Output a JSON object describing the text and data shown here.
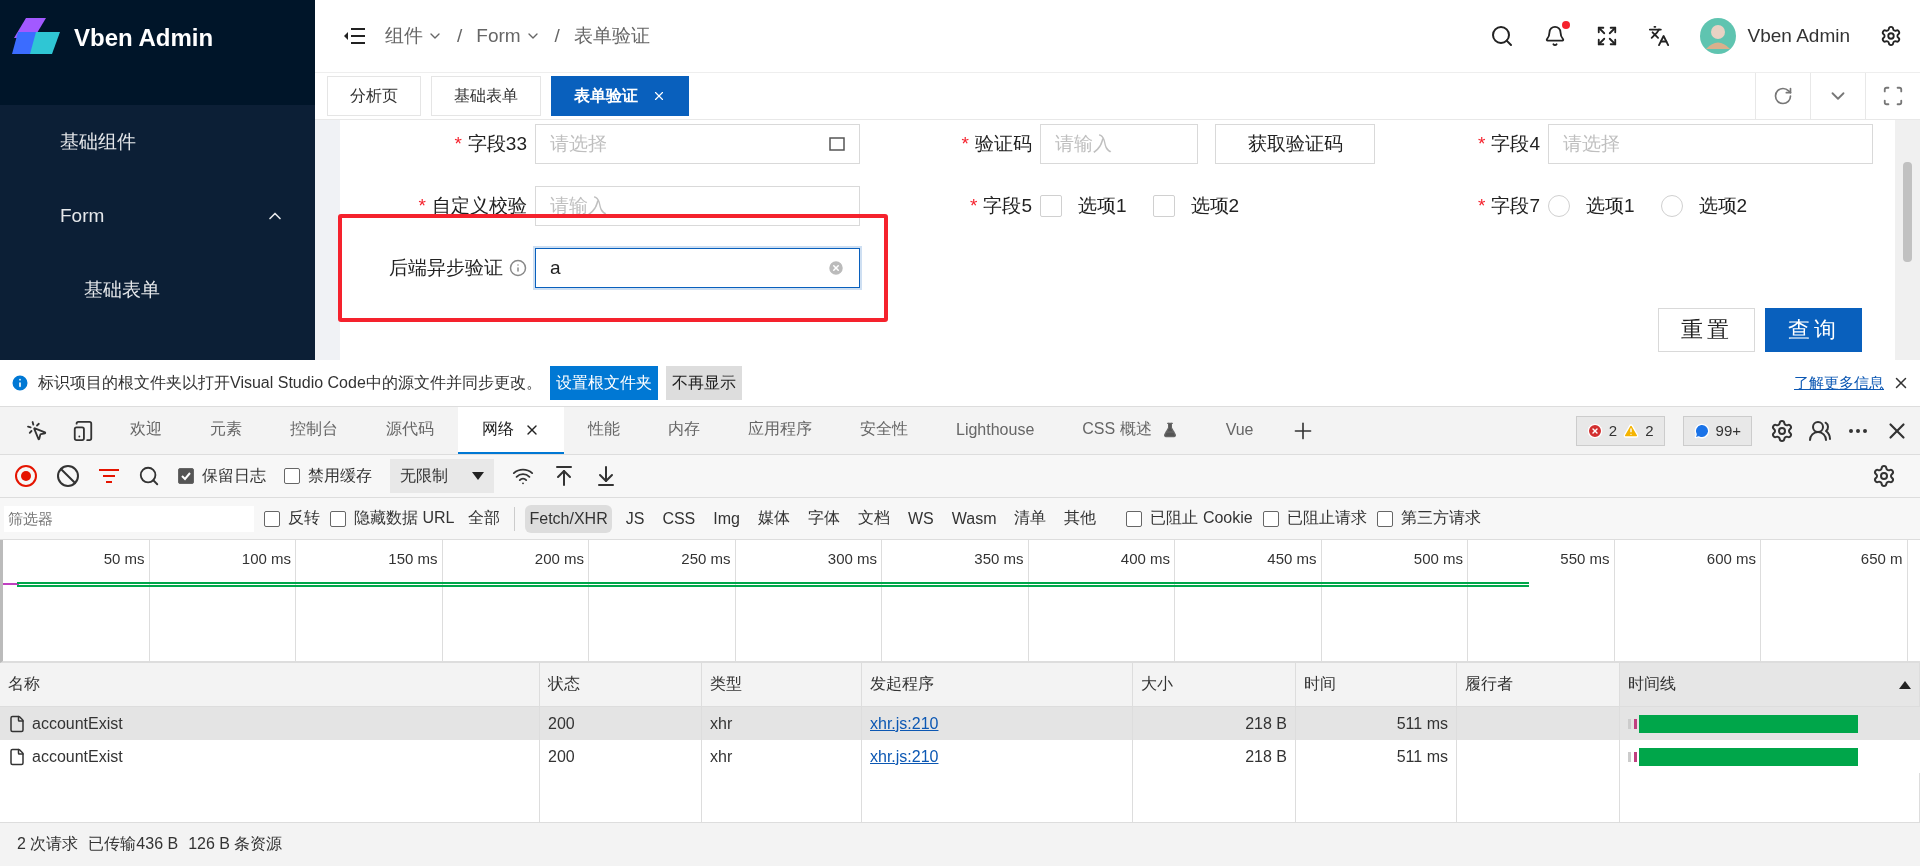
{
  "sidebar": {
    "title": "Vben Admin",
    "items": [
      {
        "kind": "link",
        "label": "基础组件"
      },
      {
        "kind": "submenu",
        "label": "Form",
        "expanded": true,
        "children": [
          {
            "kind": "link",
            "label": "基础表单"
          }
        ]
      }
    ]
  },
  "header": {
    "breadcrumb": [
      {
        "label": "组件",
        "dropdown": true
      },
      {
        "label": "Form",
        "dropdown": true
      },
      {
        "label": "表单验证",
        "dropdown": false
      }
    ],
    "separators": [
      "/",
      "/"
    ],
    "notification_dot": true,
    "user_name": "Vben Admin"
  },
  "tabs": [
    {
      "label": "分析页",
      "selected": false
    },
    {
      "label": "基础表单",
      "selected": false
    },
    {
      "label": "表单验证",
      "selected": true
    }
  ],
  "form": {
    "rows": [
      [
        {
          "kind": "select",
          "label": "字段33",
          "required_mark": "*",
          "placeholder": "请选择",
          "suffix_icon": true
        },
        {
          "kind": "input_button",
          "label": "验证码",
          "required_mark": "*",
          "placeholder": "请输入",
          "button": "获取验证码"
        },
        {
          "kind": "select",
          "label": "字段4",
          "required_mark": "*",
          "placeholder": "请选择",
          "suffix_icon": false
        }
      ],
      [
        {
          "kind": "input",
          "label": "自定义校验",
          "required_mark": "*",
          "placeholder": "请输入"
        },
        {
          "kind": "checkbox_group",
          "label": "字段5",
          "required_mark": "*",
          "options": [
            {
              "label": "选项1",
              "checked": false
            },
            {
              "label": "选项2",
              "checked": false
            }
          ]
        },
        {
          "kind": "radio_group",
          "label": "字段7",
          "required_mark": "*",
          "options": [
            {
              "label": "选项1",
              "selected": false
            },
            {
              "label": "选项2",
              "selected": false
            }
          ]
        }
      ],
      [
        {
          "kind": "input",
          "label": "后端异步验证",
          "info": true,
          "value": "a",
          "focused": true,
          "highlighted": true
        }
      ]
    ],
    "actions": [
      {
        "label": "重置",
        "primary": false
      },
      {
        "label": "查询",
        "primary": true
      }
    ]
  },
  "devtools": {
    "infobar": {
      "text": "标识项目的根文件夹以打开Visual Studio Code中的源文件并同步更改。",
      "buttons": [
        {
          "label": "设置根文件夹",
          "primary": true
        },
        {
          "label": "不再显示",
          "primary": false
        }
      ],
      "link": "了解更多信息"
    },
    "tabs": [
      {
        "label": "欢迎",
        "selected": false,
        "experimental": false
      },
      {
        "label": "元素",
        "selected": false,
        "experimental": false
      },
      {
        "label": "控制台",
        "selected": false,
        "experimental": false
      },
      {
        "label": "源代码",
        "selected": false,
        "experimental": false
      },
      {
        "label": "网络",
        "selected": true,
        "experimental": false
      },
      {
        "label": "性能",
        "selected": false,
        "experimental": false
      },
      {
        "label": "内存",
        "selected": false,
        "experimental": false
      },
      {
        "label": "应用程序",
        "selected": false,
        "experimental": false
      },
      {
        "label": "安全性",
        "selected": false,
        "experimental": false
      },
      {
        "label": "Lighthouse",
        "selected": false,
        "experimental": false
      },
      {
        "label": "CSS 概述",
        "selected": false,
        "experimental": true
      },
      {
        "label": "Vue",
        "selected": false,
        "experimental": false
      }
    ],
    "counters": {
      "errors": "2",
      "warnings": "2",
      "messages": "99+"
    },
    "toolbar": {
      "recording": true,
      "options": [
        {
          "label": "保留日志",
          "checked": true
        },
        {
          "label": "禁用缓存",
          "checked": false
        }
      ],
      "throttling": "无限制"
    },
    "filter": {
      "placeholder": "筛选器",
      "options": [
        {
          "label": "反转",
          "checked": false
        },
        {
          "label": "隐藏数据 URL",
          "checked": false
        }
      ],
      "types": [
        {
          "label": "全部",
          "selected": false
        },
        {
          "label": "Fetch/XHR",
          "selected": true
        },
        {
          "label": "JS",
          "selected": false
        },
        {
          "label": "CSS",
          "selected": false
        },
        {
          "label": "Img",
          "selected": false
        },
        {
          "label": "媒体",
          "selected": false
        },
        {
          "label": "字体",
          "selected": false
        },
        {
          "label": "文档",
          "selected": false
        },
        {
          "label": "WS",
          "selected": false
        },
        {
          "label": "Wasm",
          "selected": false
        },
        {
          "label": "清单",
          "selected": false
        },
        {
          "label": "其他",
          "selected": false
        }
      ],
      "extra_options": [
        {
          "label": "已阻止 Cookie",
          "checked": false
        },
        {
          "label": "已阻止请求",
          "checked": false
        },
        {
          "label": "第三方请求",
          "checked": false
        }
      ]
    },
    "overview": {
      "ticks": [
        "50 ms",
        "100 ms",
        "150 ms",
        "200 ms",
        "250 ms",
        "300 ms",
        "350 ms",
        "400 ms",
        "450 ms",
        "500 ms",
        "550 ms",
        "600 ms",
        "650 m"
      ]
    },
    "table": {
      "columns": [
        {
          "label": "名称",
          "sorted": false
        },
        {
          "label": "状态",
          "sorted": false
        },
        {
          "label": "类型",
          "sorted": false
        },
        {
          "label": "发起程序",
          "sorted": false
        },
        {
          "label": "大小",
          "sorted": false
        },
        {
          "label": "时间",
          "sorted": false
        },
        {
          "label": "履行者",
          "sorted": false
        },
        {
          "label": "时间线",
          "sorted": true
        }
      ],
      "rows": [
        {
          "name": "accountExist",
          "status": "200",
          "type": "xhr",
          "initiator": "xhr.js:210",
          "size": "218 B",
          "time": "511 ms",
          "highlighted": true
        },
        {
          "name": "accountExist",
          "status": "200",
          "type": "xhr",
          "initiator": "xhr.js:210",
          "size": "218 B",
          "time": "511 ms",
          "highlighted": false
        }
      ]
    },
    "status_bar": [
      "2 次请求",
      "已传输436 B",
      "126 B 条资源"
    ]
  }
}
